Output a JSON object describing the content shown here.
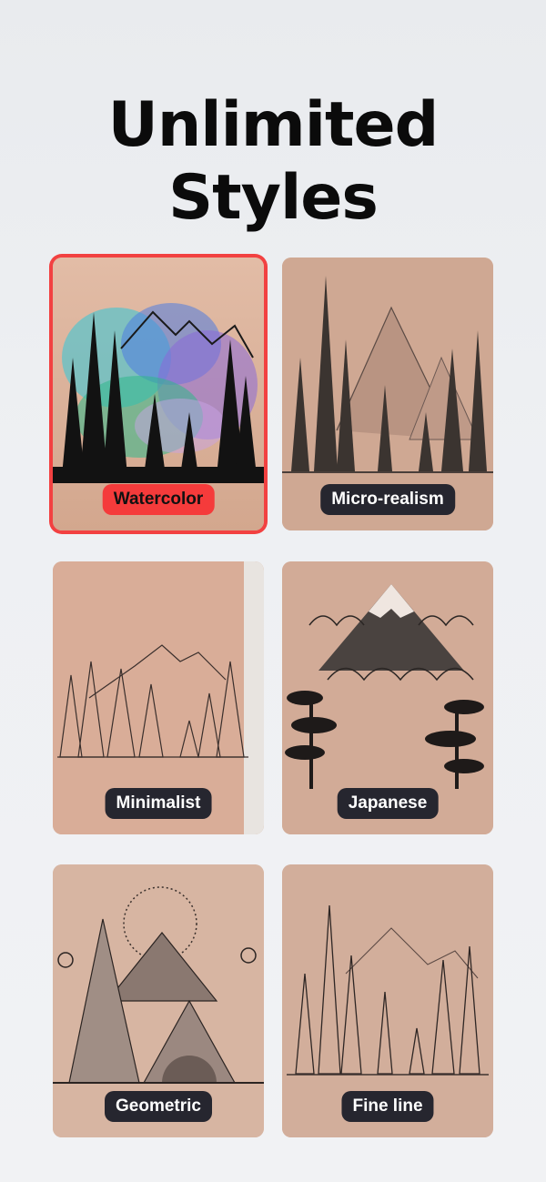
{
  "header": {
    "line1": "Unlimited",
    "line2": "Styles"
  },
  "styles": [
    {
      "label": "Watercolor",
      "selected": true,
      "icon": "watercolor-forest-tattoo"
    },
    {
      "label": "Micro-realism",
      "selected": false,
      "icon": "micro-realism-forest-tattoo"
    },
    {
      "label": "Minimalist",
      "selected": false,
      "icon": "minimalist-forest-tattoo"
    },
    {
      "label": "Japanese",
      "selected": false,
      "icon": "japanese-mountain-tattoo"
    },
    {
      "label": "Geometric",
      "selected": false,
      "icon": "geometric-mountain-tattoo"
    },
    {
      "label": "Fine line",
      "selected": false,
      "icon": "fine-line-forest-tattoo"
    }
  ],
  "colors": {
    "selected_accent": "#f24141",
    "pill_background": "#26262f",
    "skin": "#d9b8a3"
  }
}
